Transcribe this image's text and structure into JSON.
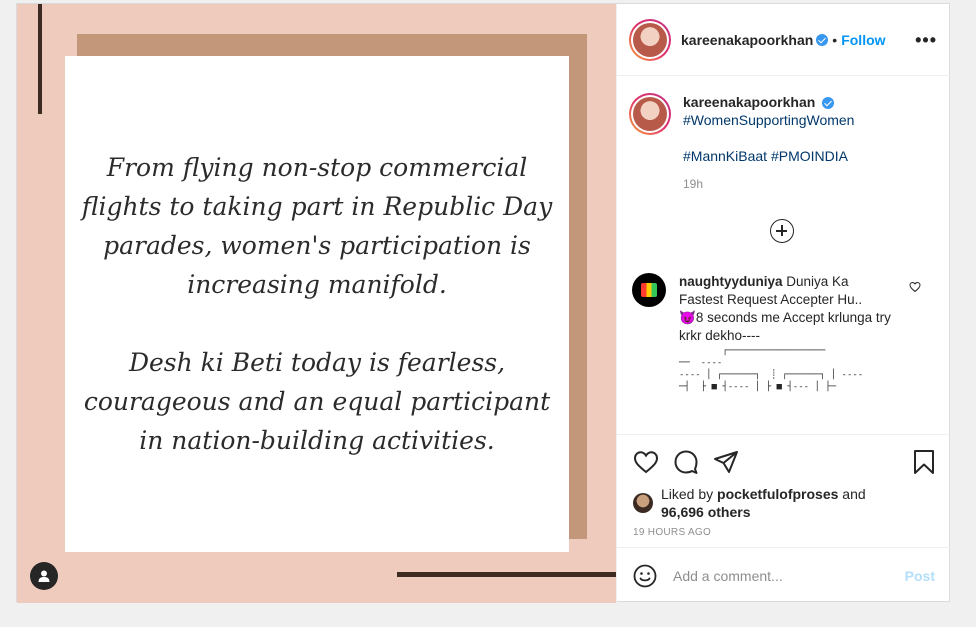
{
  "post": {
    "quote": {
      "paragraph1": "From flying non-stop commercial flights to taking part in Republic Day parades, women's participation is increasing manifold.",
      "paragraph2": "Desh ki Beti today is fearless, courageous and an equal participant in nation-building activities."
    },
    "header": {
      "username": "kareenakapoorkhan",
      "separator": "•",
      "follow_label": "Follow",
      "more_icon": "more-options-icon"
    },
    "caption": {
      "username": "kareenakapoorkhan",
      "hashtag1": "#WomenSupportingWomen",
      "hashtag2": "#MannKiBaat",
      "hashtag3": "#PMOINDIA",
      "time": "19h"
    },
    "comment": {
      "username": "naughtyyduniya",
      "text": "Duniya Ka Fastest Request Accepter Hu..",
      "emoji": "😈",
      "line2": "8 seconds me Accept krlunga try krkr dekho----",
      "ascii": "        ┌──────────────────\n──  ----\n---- │ ┌──────┐  ┊ ┌──────┐ │ ----\n─┤  ├ ■ ┤---- │ ├ ■ ┤--- │ ├─"
    },
    "likes": {
      "prefix": "Liked by",
      "user": "pocketfulofproses",
      "middle": "and",
      "count": "96,696 others"
    },
    "timestamp": "19 HOURS AGO",
    "add_comment": {
      "placeholder": "Add a comment...",
      "post_label": "Post"
    },
    "colors": {
      "accent": "#0095f6",
      "media_bg": "#efcbbe",
      "shadow_box": "#c2977a",
      "dark_line": "#3d2a20"
    }
  }
}
